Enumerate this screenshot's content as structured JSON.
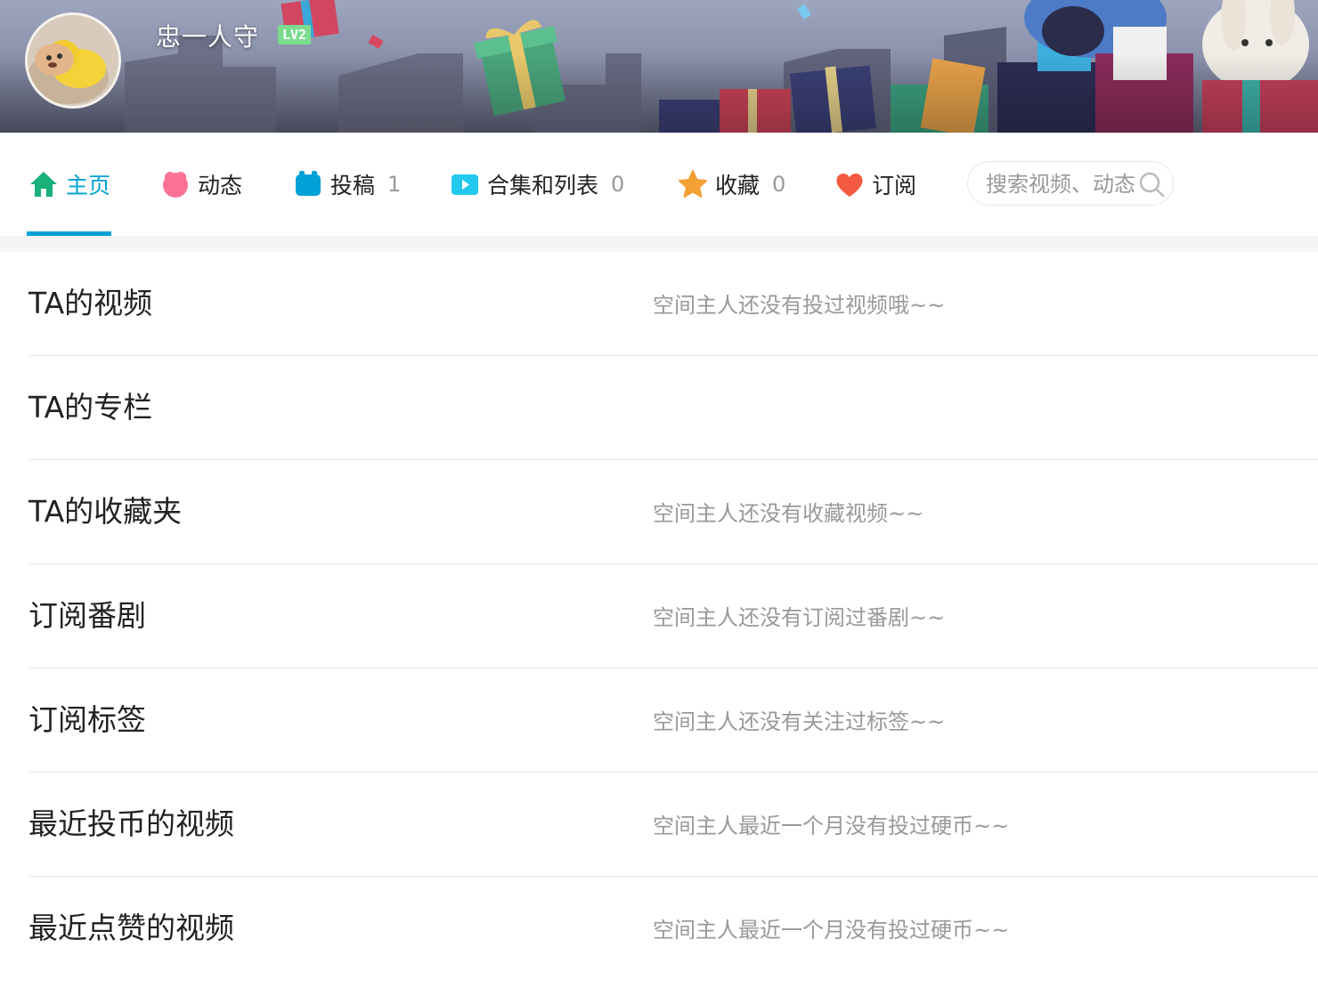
{
  "header": {
    "username": "忠一人守",
    "level": "LV2"
  },
  "nav": {
    "items": [
      {
        "label": "主页",
        "count": "",
        "icon": "home-icon",
        "color": "#00a1d6"
      },
      {
        "label": "动态",
        "count": "",
        "icon": "dynamic-icon",
        "color": "#fb7299"
      },
      {
        "label": "投稿",
        "count": "1",
        "icon": "upload-icon",
        "color": "#00a1d6"
      },
      {
        "label": "合集和列表",
        "count": "0",
        "icon": "collection-icon",
        "color": "#23c9ed"
      },
      {
        "label": "收藏",
        "count": "0",
        "icon": "favorite-star-icon",
        "color": "#f3a034"
      },
      {
        "label": "订阅",
        "count": "",
        "icon": "subscribe-heart-icon",
        "color": "#f45a41"
      }
    ],
    "search_placeholder": "搜索视频、动态"
  },
  "sections": [
    {
      "title": "TA的视频",
      "empty_text": "空间主人还没有投过视频哦~~"
    },
    {
      "title": "TA的专栏",
      "empty_text": ""
    },
    {
      "title": "TA的收藏夹",
      "empty_text": "空间主人还没有收藏视频~~"
    },
    {
      "title": "订阅番剧",
      "empty_text": "空间主人还没有订阅过番剧~~"
    },
    {
      "title": "订阅标签",
      "empty_text": "空间主人还没有关注过标签~~"
    },
    {
      "title": "最近投币的视频",
      "empty_text": "空间主人最近一个月没有投过硬币~~"
    },
    {
      "title": "最近点赞的视频",
      "empty_text": "空间主人最近一个月没有投过硬币~~"
    }
  ],
  "colors": {
    "accent": "#00a1d6",
    "level_badge": "#7bdc8e",
    "muted_text": "#999999"
  }
}
